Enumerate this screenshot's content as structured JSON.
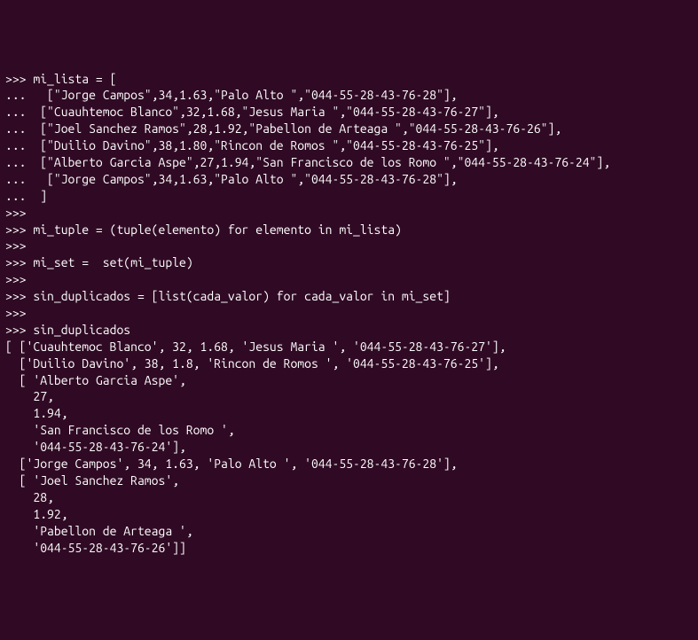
{
  "terminal": {
    "lines": [
      ">>> mi_lista = [",
      "...   [\"Jorge Campos\",34,1.63,\"Palo Alto \",\"044-55-28-43-76-28\"],",
      "...  [\"Cuauhtemoc Blanco\",32,1.68,\"Jesus Maria \",\"044-55-28-43-76-27\"],",
      "...  [\"Joel Sanchez Ramos\",28,1.92,\"Pabellon de Arteaga \",\"044-55-28-43-76-26\"],",
      "...  [\"Duilio Davino\",38,1.80,\"Rincon de Romos \",\"044-55-28-43-76-25\"],",
      "...  [\"Alberto Garcia Aspe\",27,1.94,\"San Francisco de los Romo \",\"044-55-28-43-76-24\"],",
      "...   [\"Jorge Campos\",34,1.63,\"Palo Alto \",\"044-55-28-43-76-28\"],",
      "...  ]",
      ">>>",
      ">>> mi_tuple = (tuple(elemento) for elemento in mi_lista)",
      ">>>",
      ">>> mi_set =  set(mi_tuple)",
      ">>>",
      ">>> sin_duplicados = [list(cada_valor) for cada_valor in mi_set]",
      ">>>",
      ">>> sin_duplicados",
      "[ ['Cuauhtemoc Blanco', 32, 1.68, 'Jesus Maria ', '044-55-28-43-76-27'],",
      "  ['Duilio Davino', 38, 1.8, 'Rincon de Romos ', '044-55-28-43-76-25'],",
      "  [ 'Alberto Garcia Aspe',",
      "    27,",
      "    1.94,",
      "    'San Francisco de los Romo ',",
      "    '044-55-28-43-76-24'],",
      "  ['Jorge Campos', 34, 1.63, 'Palo Alto ', '044-55-28-43-76-28'],",
      "  [ 'Joel Sanchez Ramos',",
      "    28,",
      "    1.92,",
      "    'Pabellon de Arteaga ',",
      "    '044-55-28-43-76-26']]"
    ]
  }
}
